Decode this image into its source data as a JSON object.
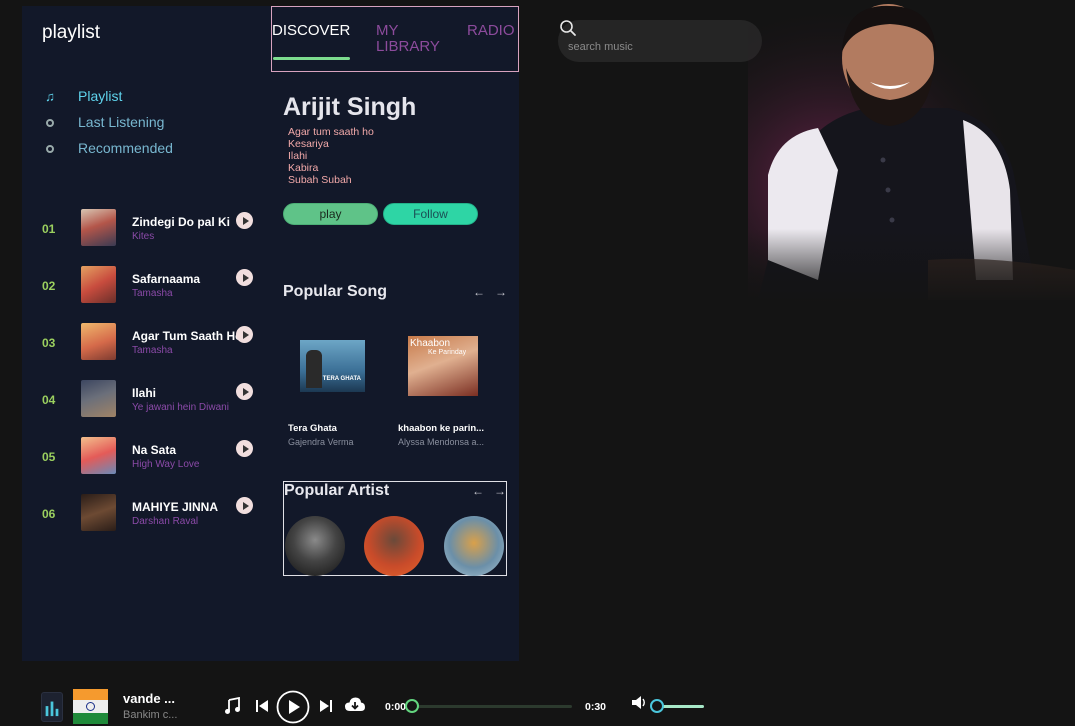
{
  "sidebar": {
    "title": "playlist",
    "nav": [
      {
        "label": "Playlist",
        "icon": "music-note-icon",
        "active": true
      },
      {
        "label": "Last Listening",
        "icon": "circle-icon",
        "active": false
      },
      {
        "label": "Recommended",
        "icon": "circle-icon",
        "active": false
      }
    ],
    "tracks": [
      {
        "num": "01",
        "name": "Zindegi Do pal Ki",
        "artist": "Kites"
      },
      {
        "num": "02",
        "name": "Safarnaama",
        "artist": "Tamasha"
      },
      {
        "num": "03",
        "name": "Agar Tum Saath Hoo",
        "artist": "Tamasha"
      },
      {
        "num": "04",
        "name": "Ilahi",
        "artist": "Ye jawani hein Diwani"
      },
      {
        "num": "05",
        "name": "Na Sata",
        "artist": "High Way Love"
      },
      {
        "num": "06",
        "name": "MAHIYE JINNA",
        "artist": "Darshan Raval"
      }
    ]
  },
  "tabs": {
    "discover": "DISCOVER",
    "library_line1": "MY",
    "library_line2": "LIBRARY",
    "radio": "RADIO"
  },
  "featured": {
    "artist": "Arijit Singh",
    "songs": [
      "Agar tum saath ho",
      "Kesariya",
      "Ilahi",
      "Kabira",
      "Subah Subah"
    ],
    "play_label": "play",
    "follow_label": "Follow"
  },
  "popular_song": {
    "title": "Popular Song",
    "prev": "←",
    "next": "→",
    "items": [
      {
        "name": "Tera Ghata",
        "artist": "Gajendra Verma",
        "cover_text": "TERA GHATA"
      },
      {
        "name": "khaabon ke parin...",
        "artist": "Alyssa Mendonsa a...",
        "cover_text_1": "Khaabon",
        "cover_text_2": "Ke Parinday"
      }
    ]
  },
  "popular_artist": {
    "title": "Popular Artist",
    "prev": "←",
    "next": "→"
  },
  "search": {
    "placeholder": "search music"
  },
  "player": {
    "title": "vande ...",
    "artist": "Bankim c...",
    "current_time": "0:00",
    "total_time": "0:30",
    "progress": 0.0,
    "volume": 0.0
  },
  "colors": {
    "panel": "#121829",
    "accent_green": "#7ddc8f",
    "accent_cyan": "#5fd3ec",
    "track_artist": "#8b4aa8",
    "song_list": "#f2a9a9"
  }
}
